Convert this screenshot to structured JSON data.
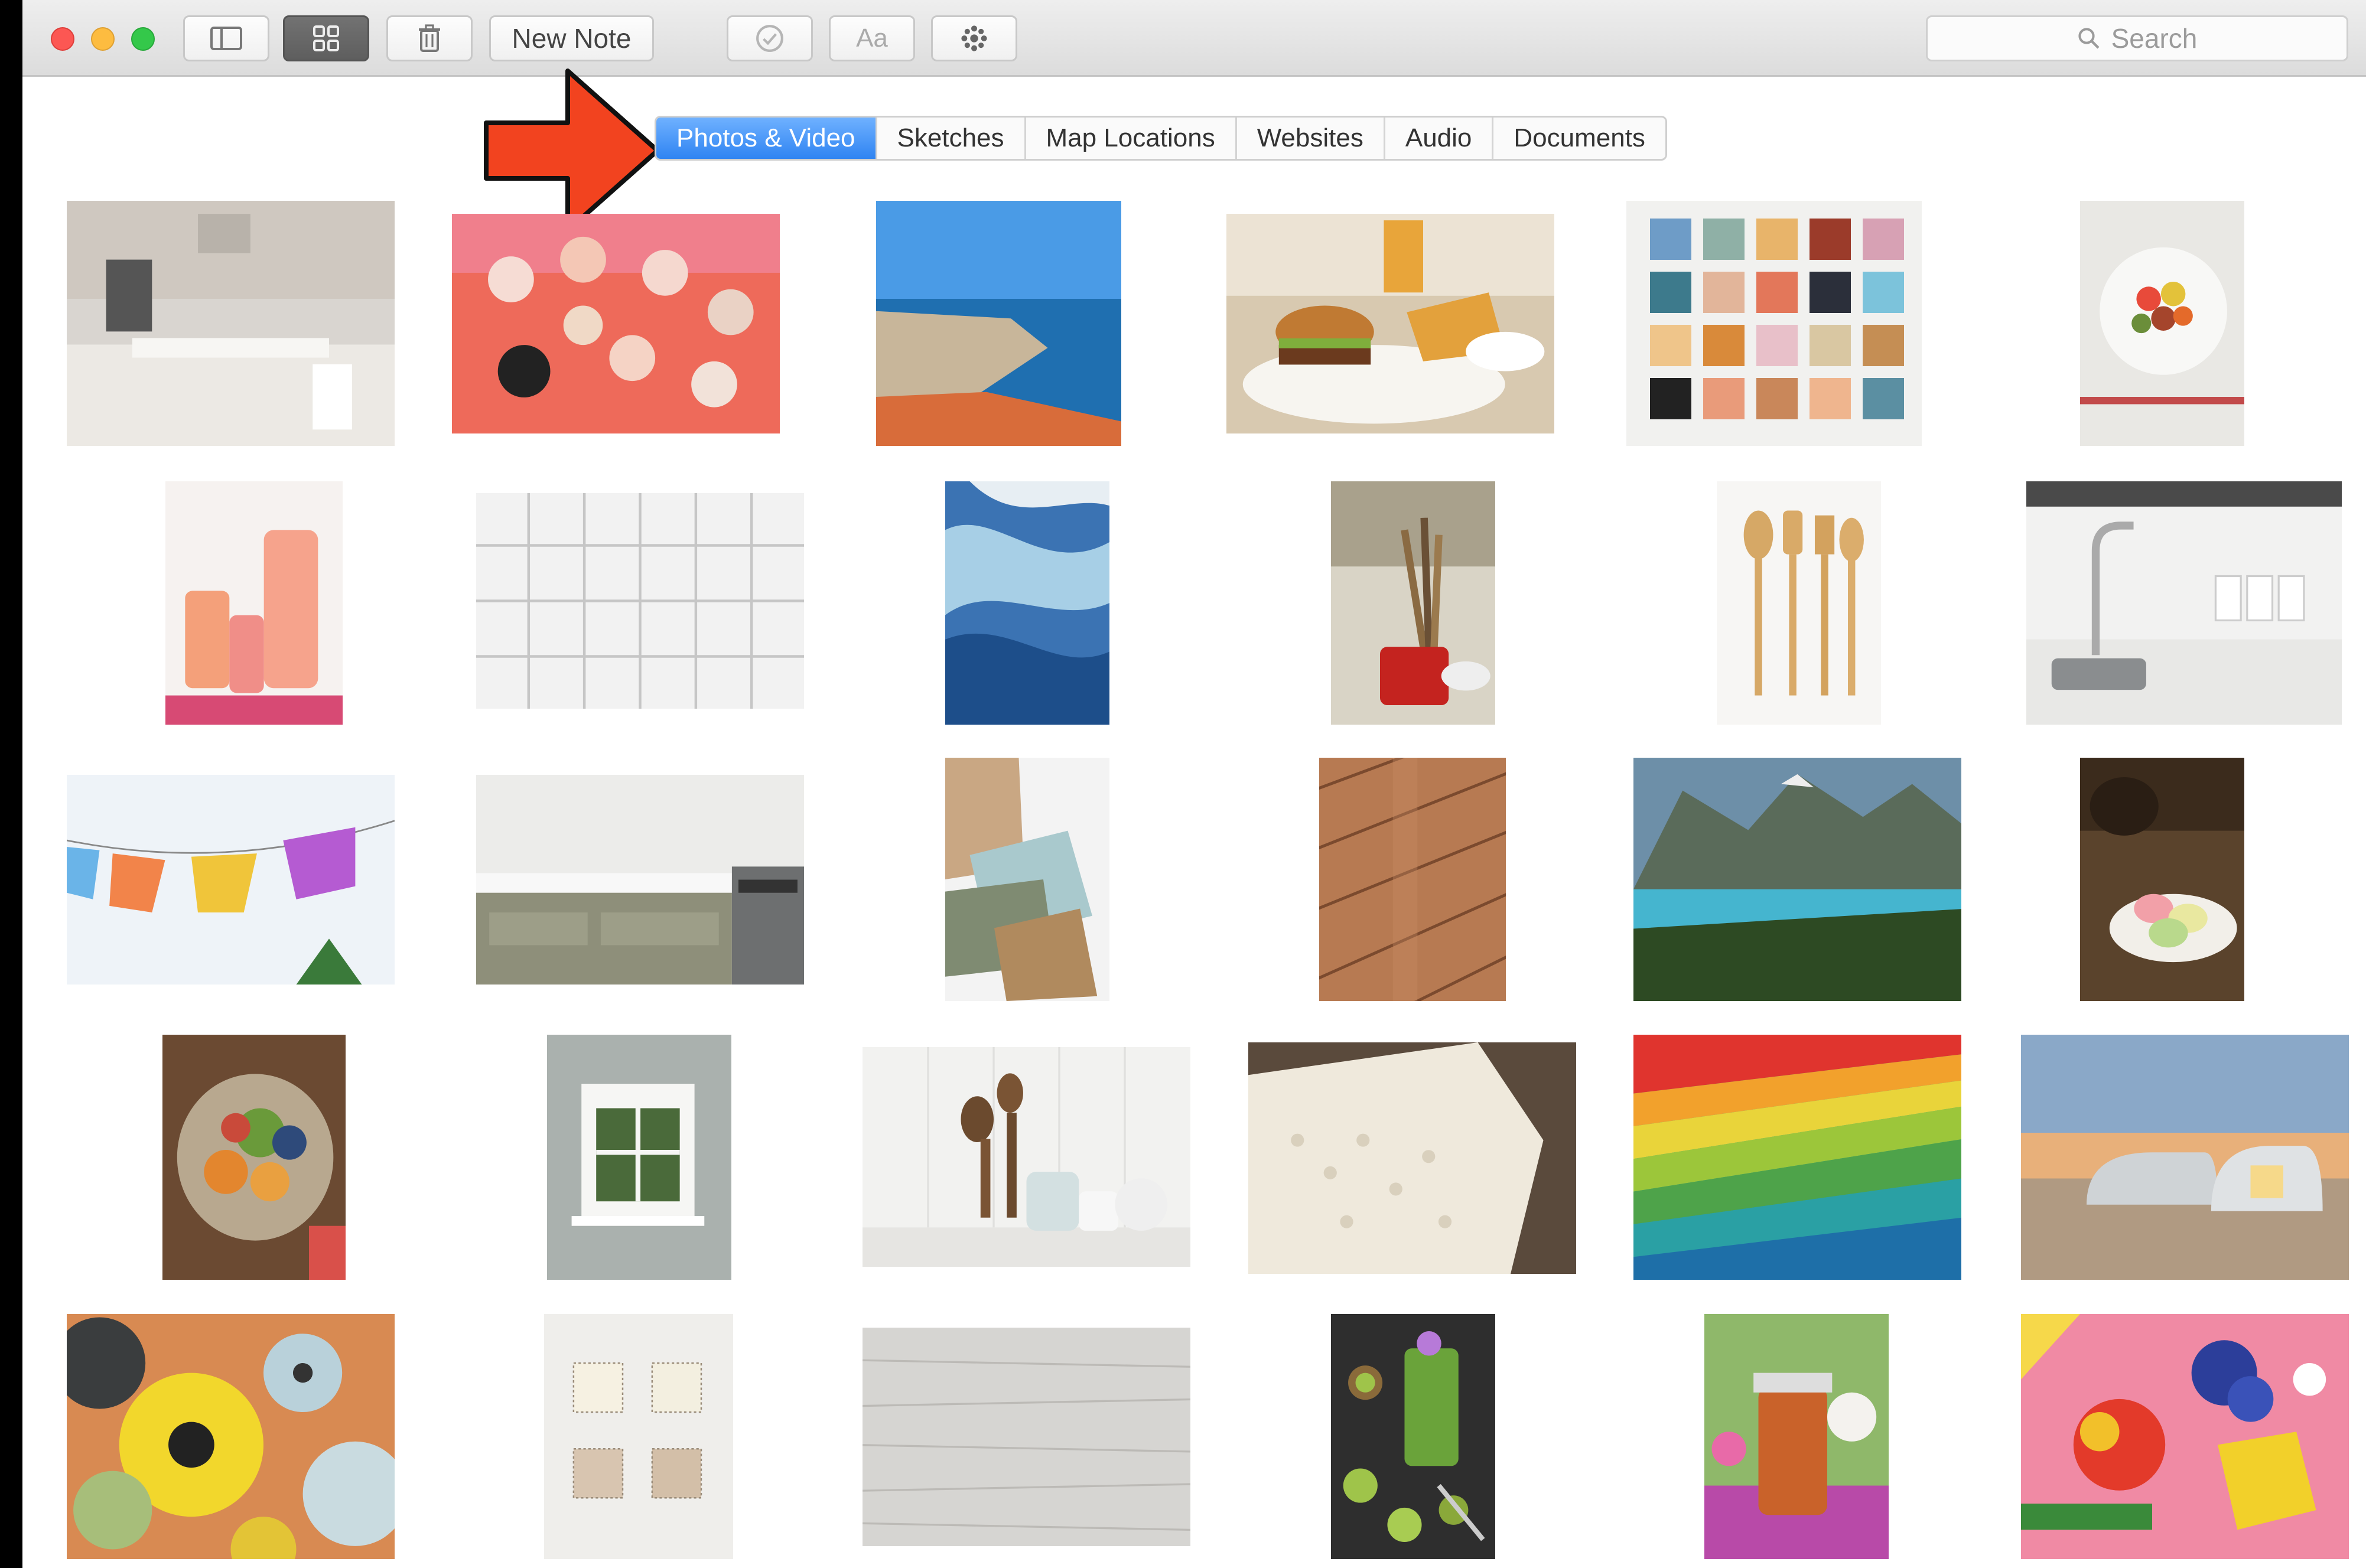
{
  "toolbar": {
    "new_note_label": "New Note",
    "font_label": "Aa",
    "search_placeholder": "Search"
  },
  "tabs": [
    {
      "label": "Photos & Video",
      "selected": true
    },
    {
      "label": "Sketches",
      "selected": false
    },
    {
      "label": "Map Locations",
      "selected": false
    },
    {
      "label": "Websites",
      "selected": false
    },
    {
      "label": "Audio",
      "selected": false
    },
    {
      "label": "Documents",
      "selected": false
    }
  ],
  "icons": [
    "sidebar-toggle-icon",
    "gallery-grid-icon",
    "trash-icon",
    "checklist-icon",
    "share-icon",
    "search-icon"
  ],
  "colors": {
    "accent": "#2f84f2",
    "arrow": "#f2431f"
  },
  "attachments": [
    {
      "subject": "kitchen"
    },
    {
      "subject": "cupcakes"
    },
    {
      "subject": "coastal-town"
    },
    {
      "subject": "burger"
    },
    {
      "subject": "color-swatches"
    },
    {
      "subject": "fruit-bowl"
    },
    {
      "subject": "pink-drinks"
    },
    {
      "subject": "white-tiles"
    },
    {
      "subject": "blue-fabric"
    },
    {
      "subject": "utensils-in-mug"
    },
    {
      "subject": "wooden-utensils"
    },
    {
      "subject": "kitchen-sink"
    },
    {
      "subject": "paper-flags"
    },
    {
      "subject": "stove-counter"
    },
    {
      "subject": "fabric-samples"
    },
    {
      "subject": "wood-floor"
    },
    {
      "subject": "mountain-lake"
    },
    {
      "subject": "macarons"
    },
    {
      "subject": "fruit-platter"
    },
    {
      "subject": "window"
    },
    {
      "subject": "wooden-spoons"
    },
    {
      "subject": "lace-fabric"
    },
    {
      "subject": "colorful-fabric"
    },
    {
      "subject": "airstream-trailer"
    },
    {
      "subject": "vases"
    },
    {
      "subject": "fabric-tags"
    },
    {
      "subject": "white-wood"
    },
    {
      "subject": "green-smoothie"
    },
    {
      "subject": "tea-jar"
    },
    {
      "subject": "oilcloth-pattern"
    }
  ]
}
